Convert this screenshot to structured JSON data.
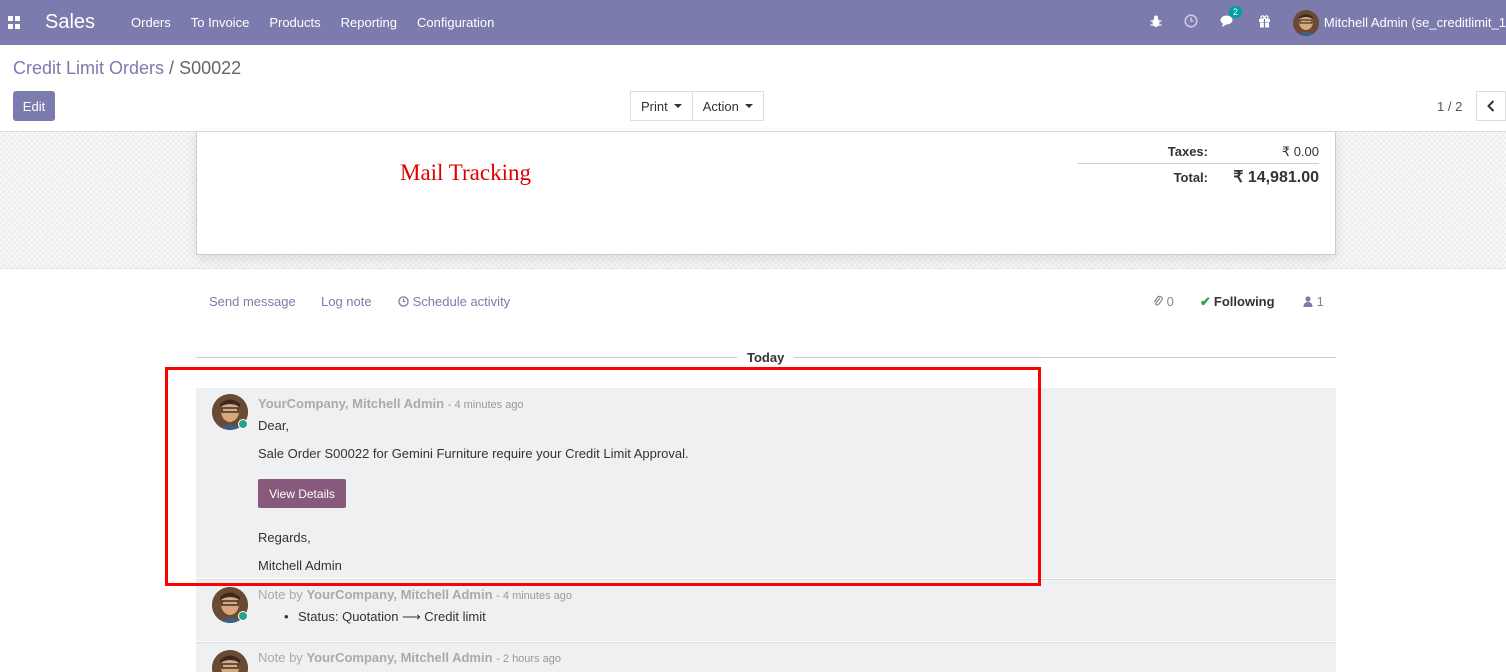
{
  "navbar": {
    "app_name": "Sales",
    "menu": [
      "Orders",
      "To Invoice",
      "Products",
      "Reporting",
      "Configuration"
    ],
    "messages_badge": "2",
    "user": "Mitchell Admin (se_creditlimit_1"
  },
  "breadcrumb": {
    "parent": "Credit Limit Orders",
    "separator": "/",
    "current": "S00022"
  },
  "buttons": {
    "edit": "Edit",
    "print": "Print",
    "action": "Action"
  },
  "pager": {
    "label": "1 / 2"
  },
  "form": {
    "annotation": "Mail Tracking",
    "taxes_label": "Taxes:",
    "taxes_value": "₹ 0.00",
    "total_label": "Total:",
    "total_value": "₹ 14,981.00"
  },
  "chatter": {
    "send_message": "Send message",
    "log_note": "Log note",
    "schedule_activity": "Schedule activity",
    "attachments_count": "0",
    "following": "Following",
    "followers_count": "1",
    "date_separator": "Today"
  },
  "messages": [
    {
      "author": "YourCompany, Mitchell Admin",
      "time": "- 4 minutes ago",
      "line1": "Dear,",
      "line2": "Sale Order S00022 for Gemini Furniture require your Credit Limit Approval.",
      "button": "View Details",
      "line3": "Regards,",
      "line4": "Mitchell Admin"
    },
    {
      "prefix": "Note by",
      "author": "YourCompany, Mitchell Admin",
      "time": "- 4 minutes ago",
      "tracking": "Status: Quotation ⟶ Credit limit"
    },
    {
      "prefix": "Note by",
      "author": "YourCompany, Mitchell Admin",
      "time": "- 2 hours ago"
    }
  ],
  "colors": {
    "brand": "#7c7bad",
    "highlight_border": "#ff0000",
    "button_primary": "#875a7b"
  }
}
